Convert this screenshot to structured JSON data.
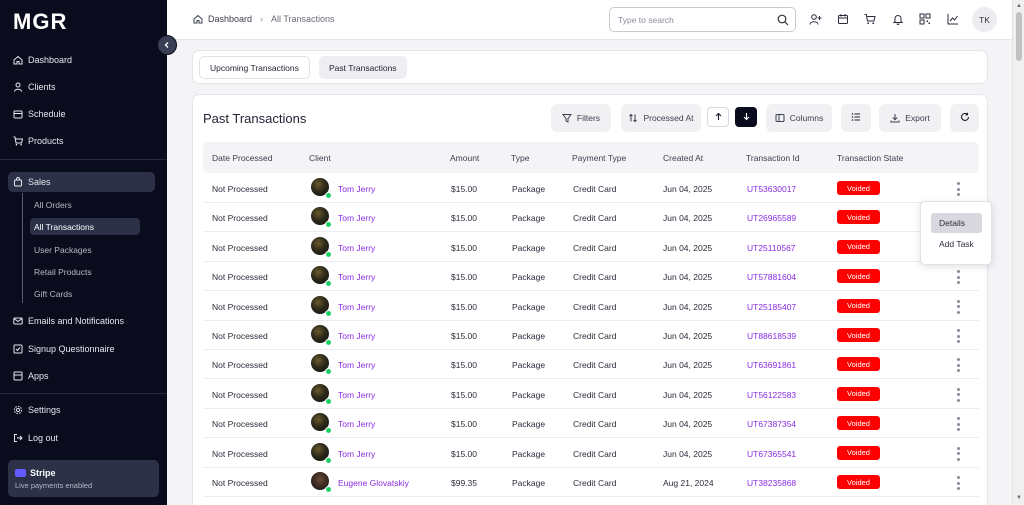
{
  "app": {
    "logo": "MGR"
  },
  "sidebar": {
    "items": [
      {
        "label": "Dashboard",
        "icon": "home-icon"
      },
      {
        "label": "Clients",
        "icon": "user-icon"
      },
      {
        "label": "Schedule",
        "icon": "calendar-icon"
      },
      {
        "label": "Products",
        "icon": "cart-icon"
      },
      {
        "label": "Sales",
        "icon": "shopping-bag-icon",
        "active": true
      },
      {
        "label": "Emails and Notifications",
        "icon": "mail-icon"
      },
      {
        "label": "Signup Questionnaire",
        "icon": "checkbox-icon"
      },
      {
        "label": "Apps",
        "icon": "apps-icon"
      },
      {
        "label": "Settings",
        "icon": "gear-icon"
      },
      {
        "label": "Log out",
        "icon": "logout-icon"
      }
    ],
    "sales_sub": [
      {
        "label": "All Orders"
      },
      {
        "label": "All Transactions",
        "active": true
      },
      {
        "label": "User Packages"
      },
      {
        "label": "Retail Products"
      },
      {
        "label": "Gift Cards"
      }
    ],
    "stripe": {
      "title": "Stripe",
      "subtitle": "Live payments enabled"
    }
  },
  "header": {
    "breadcrumb": {
      "home": "Dashboard",
      "current": "All Transactions"
    },
    "search": {
      "placeholder": "Type to search"
    },
    "avatar_initials": "TK"
  },
  "tabs": [
    {
      "label": "Upcoming Transactions"
    },
    {
      "label": "Past Transactions",
      "active": true
    }
  ],
  "main": {
    "title": "Past Transactions",
    "toolbar": {
      "filters": "Filters",
      "sort_field": "Processed At",
      "columns": "Columns",
      "export": "Export"
    },
    "columns": [
      "Date Processed",
      "Client",
      "Amount",
      "Type",
      "Payment Type",
      "Created At",
      "Transaction Id",
      "Transaction State"
    ],
    "rows": [
      {
        "date_processed": "Not Processed",
        "client": "Tom Jerry",
        "amount": "$15.00",
        "type": "Package",
        "payment_type": "Credit Card",
        "created_at": "Jun 04, 2025",
        "txn_id": "UT53630017",
        "state": "Voided"
      },
      {
        "date_processed": "Not Processed",
        "client": "Tom Jerry",
        "amount": "$15.00",
        "type": "Package",
        "payment_type": "Credit Card",
        "created_at": "Jun 04, 2025",
        "txn_id": "UT26965589",
        "state": "Voided"
      },
      {
        "date_processed": "Not Processed",
        "client": "Tom Jerry",
        "amount": "$15.00",
        "type": "Package",
        "payment_type": "Credit Card",
        "created_at": "Jun 04, 2025",
        "txn_id": "UT25110567",
        "state": "Voided"
      },
      {
        "date_processed": "Not Processed",
        "client": "Tom Jerry",
        "amount": "$15.00",
        "type": "Package",
        "payment_type": "Credit Card",
        "created_at": "Jun 04, 2025",
        "txn_id": "UT57881604",
        "state": "Voided"
      },
      {
        "date_processed": "Not Processed",
        "client": "Tom Jerry",
        "amount": "$15.00",
        "type": "Package",
        "payment_type": "Credit Card",
        "created_at": "Jun 04, 2025",
        "txn_id": "UT25185407",
        "state": "Voided"
      },
      {
        "date_processed": "Not Processed",
        "client": "Tom Jerry",
        "amount": "$15.00",
        "type": "Package",
        "payment_type": "Credit Card",
        "created_at": "Jun 04, 2025",
        "txn_id": "UT88618539",
        "state": "Voided"
      },
      {
        "date_processed": "Not Processed",
        "client": "Tom Jerry",
        "amount": "$15.00",
        "type": "Package",
        "payment_type": "Credit Card",
        "created_at": "Jun 04, 2025",
        "txn_id": "UT63691861",
        "state": "Voided"
      },
      {
        "date_processed": "Not Processed",
        "client": "Tom Jerry",
        "amount": "$15.00",
        "type": "Package",
        "payment_type": "Credit Card",
        "created_at": "Jun 04, 2025",
        "txn_id": "UT56122583",
        "state": "Voided"
      },
      {
        "date_processed": "Not Processed",
        "client": "Tom Jerry",
        "amount": "$15.00",
        "type": "Package",
        "payment_type": "Credit Card",
        "created_at": "Jun 04, 2025",
        "txn_id": "UT67387354",
        "state": "Voided"
      },
      {
        "date_processed": "Not Processed",
        "client": "Tom Jerry",
        "amount": "$15.00",
        "type": "Package",
        "payment_type": "Credit Card",
        "created_at": "Jun 04, 2025",
        "txn_id": "UT67365541",
        "state": "Voided"
      },
      {
        "date_processed": "Not Processed",
        "client": "Eugene Glovatskiy",
        "amount": "$99.35",
        "type": "Package",
        "payment_type": "Credit Card",
        "created_at": "Aug 21, 2024",
        "txn_id": "UT38235868",
        "state": "Voided"
      }
    ],
    "row_menu": {
      "details": "Details",
      "add_task": "Add Task"
    }
  },
  "colors": {
    "sidebar_bg": "#0b0b1e",
    "link": "#8a2be2",
    "voided": "#ff0000",
    "online": "#1fcf66"
  }
}
